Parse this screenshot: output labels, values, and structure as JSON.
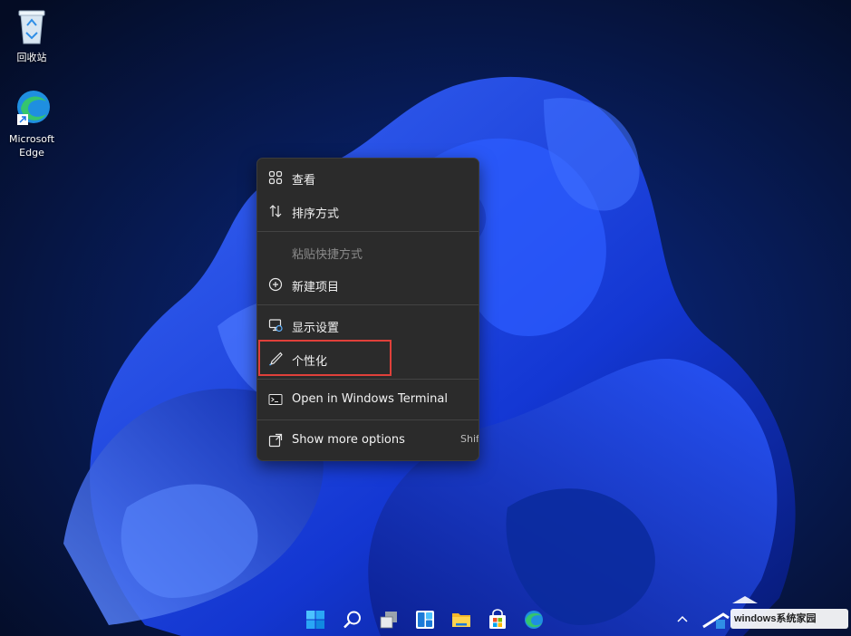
{
  "desktop": {
    "icons": [
      {
        "label": "回收站"
      },
      {
        "label_line1": "Microsoft",
        "label_line2": "Edge"
      }
    ]
  },
  "context_menu": {
    "items": [
      {
        "label": "查看",
        "icon": "view-grid-icon"
      },
      {
        "label": "排序方式",
        "icon": "sort-arrows-icon"
      },
      {
        "label": "粘贴快捷方式",
        "icon": "none",
        "disabled": true
      },
      {
        "label": "新建项目",
        "icon": "plus-circle-icon"
      },
      {
        "label": "显示设置",
        "icon": "display-settings-icon"
      },
      {
        "label": "个性化",
        "icon": "brush-icon",
        "highlighted": true
      },
      {
        "label": "Open in Windows Terminal",
        "icon": "terminal-icon"
      },
      {
        "label": "Show more options",
        "icon": "expand-icon",
        "shortcut": "Shift"
      }
    ]
  },
  "colors": {
    "menu_bg": "#2b2b2b",
    "highlight": "#e0403a",
    "wallpaper_blue": "#1a4bff"
  },
  "taskbar": {
    "icons": [
      "start-icon",
      "search-icon",
      "task-view-icon",
      "widgets-icon",
      "file-explorer-icon",
      "store-icon",
      "edge-icon"
    ],
    "tray": [
      "chevron-up-icon"
    ]
  },
  "watermark": {
    "text": "windows系统家园",
    "logo": "house-logo-icon"
  }
}
